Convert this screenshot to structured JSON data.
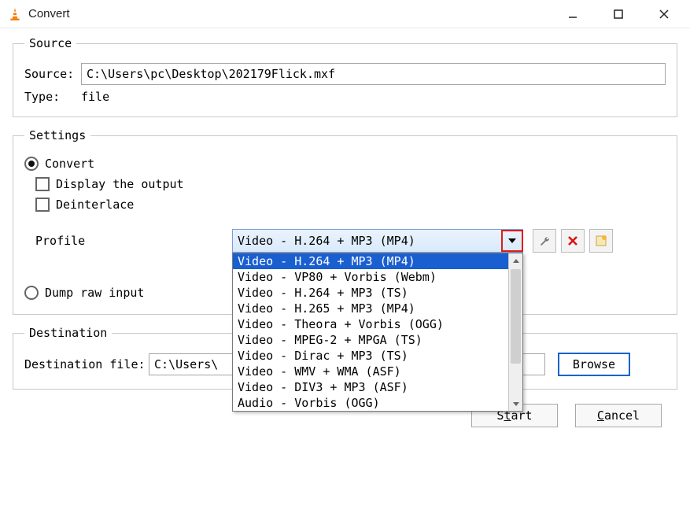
{
  "window": {
    "title": "Convert"
  },
  "source_group": {
    "legend": "Source",
    "source_label": "Source:",
    "source_value": "C:\\Users\\pc\\Desktop\\202179Flick.mxf",
    "type_label": "Type:",
    "type_value": "file"
  },
  "settings_group": {
    "legend": "Settings",
    "convert_label": "Convert",
    "display_output_label": "Display the output",
    "deinterlace_label": "Deinterlace",
    "profile_label": "Profile",
    "profile_selected": "Video - H.264 + MP3 (MP4)",
    "profile_options": [
      "Video - H.264 + MP3 (MP4)",
      "Video - VP80 + Vorbis (Webm)",
      "Video - H.264 + MP3 (TS)",
      "Video - H.265 + MP3 (MP4)",
      "Video - Theora + Vorbis (OGG)",
      "Video - MPEG-2 + MPGA (TS)",
      "Video - Dirac + MP3 (TS)",
      "Video - WMV + WMA (ASF)",
      "Video - DIV3 + MP3 (ASF)",
      "Audio - Vorbis (OGG)"
    ],
    "dump_raw_label": "Dump raw input"
  },
  "dest_group": {
    "legend": "Destination",
    "dest_label": "Destination file:",
    "dest_value": "C:\\Users\\",
    "browse_label": "Browse"
  },
  "buttons": {
    "start_pre": "S",
    "start_ul": "t",
    "start_post": "art",
    "cancel_pre": "",
    "cancel_ul": "C",
    "cancel_post": "ancel"
  }
}
